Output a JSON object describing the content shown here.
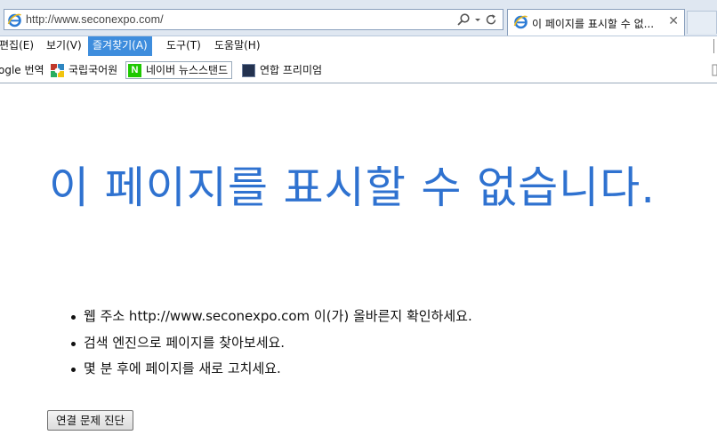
{
  "browser": {
    "address_bar": {
      "url": "http://www.seconexpo.com/",
      "search_icon": "search-icon",
      "dropdown_icon": "chevron-down-icon",
      "refresh_icon": "refresh-icon"
    },
    "tab": {
      "title": "이 페이지를 표시할 수 없...",
      "close_label": "✕",
      "icon": "ie-icon"
    },
    "menu": {
      "items": [
        {
          "label": "편집(E)",
          "active": false
        },
        {
          "label": "보기(V)",
          "active": false
        },
        {
          "label": "즐겨찾기(A)",
          "active": true
        },
        {
          "label": "도구(T)",
          "active": false
        },
        {
          "label": "도움말(H)",
          "active": false
        }
      ]
    },
    "favorites": {
      "items": [
        {
          "label": "ogle 번역",
          "icon": "none"
        },
        {
          "label": "국립국어원",
          "icon": "korean-institute-icon"
        },
        {
          "label": "네이버 뉴스스탠드",
          "icon": "naver-icon",
          "icon_text": "N"
        },
        {
          "label": "연합 프리미엄",
          "icon": "yonhap-icon"
        }
      ]
    },
    "colors": {
      "accent": "#3e8ddd",
      "title_blue": "#2f72d0",
      "chrome_bg": "#dfe7f1"
    }
  },
  "page": {
    "title": "이 페이지를 표시할 수 없습니다.",
    "suggestions": [
      "웹 주소 http://www.seconexpo.com 이(가) 올바른지 확인하세요.",
      "검색 엔진으로 페이지를 찾아보세요.",
      "몇 분 후에 페이지를 새로 고치세요."
    ],
    "diagnose_button": "연결 문제 진단"
  }
}
